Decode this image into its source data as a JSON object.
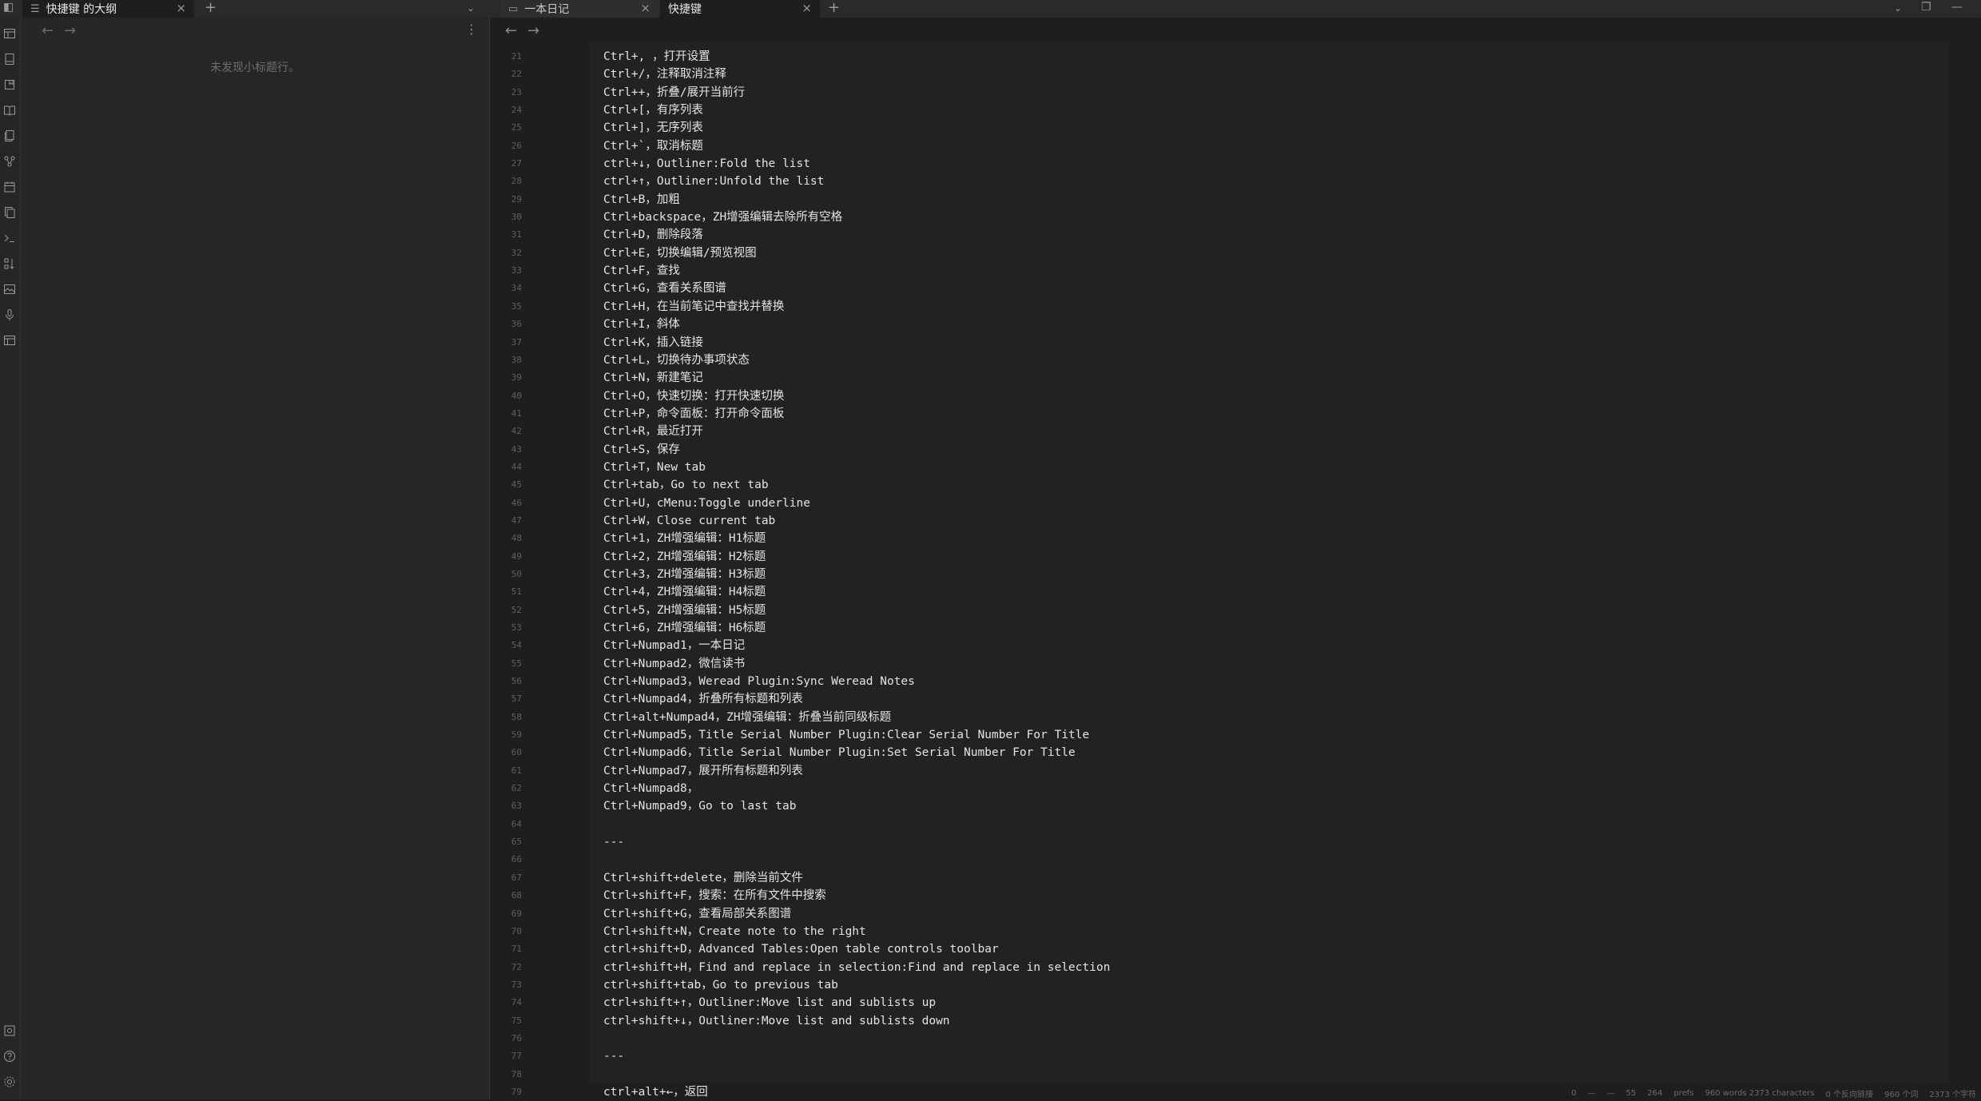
{
  "tabs_left": {
    "outline_tab_label": "快捷键 的大纲"
  },
  "tabs_right": [
    {
      "label": "一本日记"
    },
    {
      "label": "快捷键"
    }
  ],
  "outline": {
    "empty_message": "未发现小标题行。"
  },
  "editor": {
    "line_numbers": [
      "21",
      "22",
      "23",
      "24",
      "25",
      "26",
      "27",
      "28",
      "29",
      "30",
      "31",
      "32",
      "33",
      "34",
      "35",
      "36",
      "37",
      "38",
      "39",
      "40",
      "41",
      "42",
      "43",
      "44",
      "45",
      "46",
      "47",
      "48",
      "49",
      "50",
      "51",
      "52",
      "53",
      "54",
      "55",
      "56",
      "57",
      "58",
      "59",
      "60",
      "61",
      "62",
      "63",
      "64",
      "65",
      "66",
      "67",
      "68",
      "69",
      "70",
      "71",
      "72",
      "73",
      "74",
      "75",
      "76",
      "77",
      "78",
      "79"
    ],
    "lines": [
      "Ctrl+, ，打开设置",
      "Ctrl+/，注释取消注释",
      "Ctrl++，折叠/展开当前行",
      "Ctrl+[，有序列表",
      "Ctrl+]，无序列表",
      "Ctrl+`，取消标题",
      "ctrl+↓，Outliner:Fold the list",
      "ctrl+↑，Outliner:Unfold the list",
      "Ctrl+B，加粗",
      "Ctrl+backspace，ZH增强编辑去除所有空格",
      "Ctrl+D，删除段落",
      "Ctrl+E，切换编辑/预览视图",
      "Ctrl+F，查找",
      "Ctrl+G，查看关系图谱",
      "Ctrl+H，在当前笔记中查找并替换",
      "Ctrl+I，斜体",
      "Ctrl+K，插入链接",
      "Ctrl+L，切换待办事项状态",
      "Ctrl+N，新建笔记",
      "Ctrl+O，快速切换：打开快速切换",
      "Ctrl+P，命令面板：打开命令面板",
      "Ctrl+R，最近打开",
      "Ctrl+S，保存",
      "Ctrl+T，New tab",
      "Ctrl+tab，Go to next tab",
      "Ctrl+U，cMenu:Toggle underline",
      "Ctrl+W，Close current tab",
      "Ctrl+1，ZH增强编辑：H1标题",
      "Ctrl+2，ZH增强编辑：H2标题",
      "Ctrl+3，ZH增强编辑：H3标题",
      "Ctrl+4，ZH增强编辑：H4标题",
      "Ctrl+5，ZH增强编辑：H5标题",
      "Ctrl+6，ZH增强编辑：H6标题",
      "Ctrl+Numpad1，一本日记",
      "Ctrl+Numpad2，微信读书",
      "Ctrl+Numpad3，Weread Plugin:Sync Weread Notes",
      "Ctrl+Numpad4，折叠所有标题和列表",
      "Ctrl+alt+Numpad4，ZH增强编辑：折叠当前同级标题",
      "Ctrl+Numpad5，Title Serial Number Plugin:Clear Serial Number For Title",
      "Ctrl+Numpad6，Title Serial Number Plugin:Set Serial Number For Title",
      "Ctrl+Numpad7，展开所有标题和列表",
      "Ctrl+Numpad8，",
      "Ctrl+Numpad9，Go to last tab",
      "",
      "---",
      "",
      "Ctrl+shift+delete，删除当前文件",
      "Ctrl+shift+F，搜索：在所有文件中搜索",
      "Ctrl+shift+G，查看局部关系图谱",
      "Ctrl+shift+N，Create note to the right",
      "ctrl+shift+D，Advanced Tables:Open table controls toolbar",
      "ctrl+shift+H，Find and replace in selection:Find and replace in selection",
      "ctrl+shift+tab，Go to previous tab",
      "ctrl+shift+↑，Outliner:Move list and sublists up",
      "ctrl+shift+↓，Outliner:Move list and sublists down",
      "",
      "---",
      "",
      "ctrl+alt+←，返回"
    ]
  },
  "statusbar": {
    "items": [
      "0",
      "—",
      "—",
      "55",
      "264",
      "prefs",
      "960 words 2373 characters",
      "0 个反向链接",
      "960 个词",
      "2373 个字符"
    ]
  },
  "colors": {
    "background": "#1e1e1e",
    "sidebar": "#262626",
    "text": "#e4e4e4",
    "muted": "#6f6f6f"
  }
}
